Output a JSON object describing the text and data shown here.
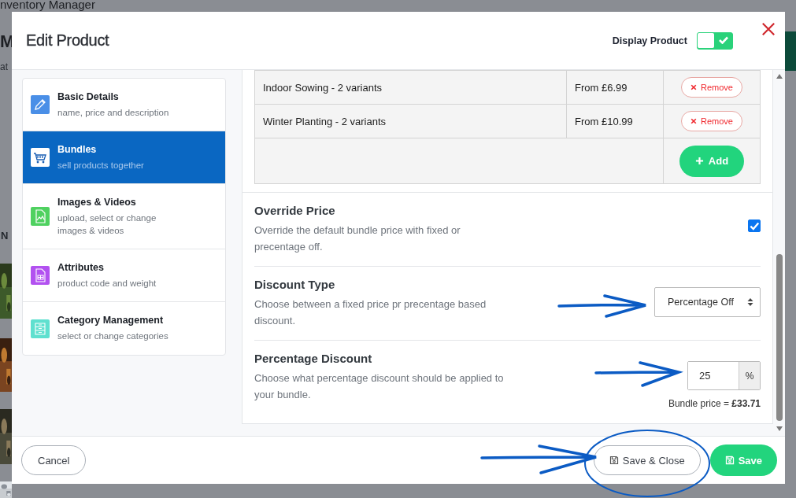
{
  "background_page": {
    "title": "nventory Manager",
    "heading": "M",
    "subtitle": "at",
    "column_header": "N"
  },
  "dialog": {
    "title": "Edit Product",
    "display_product": {
      "label": "Display Product",
      "on": true
    }
  },
  "sidebar": {
    "items": [
      {
        "title": "Basic Details",
        "subtitle": "name, price and description",
        "color": "#4a8fe7",
        "selected": false
      },
      {
        "title": "Bundles",
        "subtitle": "sell products together",
        "color": "#ffffff",
        "selected": true
      },
      {
        "title": "Images & Videos",
        "subtitle": "upload, select or change images & videos",
        "color": "#4fd160",
        "selected": false
      },
      {
        "title": "Attributes",
        "subtitle": "product code and weight",
        "color": "#b251f0",
        "selected": false
      },
      {
        "title": "Category Management",
        "subtitle": "select or change categories",
        "color": "#5fe0cf",
        "selected": false
      }
    ]
  },
  "bundle_table": {
    "rows": [
      {
        "name": "Indoor Sowing - 2 variants",
        "price": "From £6.99",
        "action": "Remove"
      },
      {
        "name": "Winter Planting - 2 variants",
        "price": "From £10.99",
        "action": "Remove"
      }
    ],
    "add_button": "Add"
  },
  "settings": [
    {
      "kind": "checkbox",
      "title": "Override Price",
      "description": "Override the default bundle price with fixed or precentage off.",
      "checked": true
    },
    {
      "kind": "select",
      "title": "Discount Type",
      "description": "Choose between a fixed price pr precentage based discount.",
      "value": "Percentage Off"
    },
    {
      "kind": "number",
      "title": "Percentage Discount",
      "description": "Choose what percentage discount should be applied to your bundle.",
      "value": "25",
      "unit": "%",
      "note": "Bundle price = **£33.71**"
    }
  ],
  "footer": {
    "cancel": "Cancel",
    "save_close": "Save & Close",
    "save": "Save"
  }
}
